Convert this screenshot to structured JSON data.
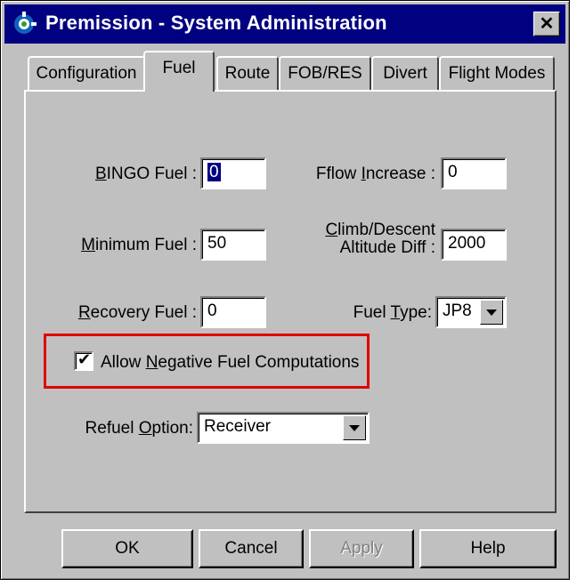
{
  "window": {
    "title": "Premission - System Administration",
    "close_glyph": "✕",
    "icon": "gear-app-icon"
  },
  "tabs": [
    {
      "label": "Configuration",
      "active": false
    },
    {
      "label": "Fuel",
      "active": true
    },
    {
      "label": "Route",
      "active": false
    },
    {
      "label": "FOB/RES",
      "active": false
    },
    {
      "label": "Divert",
      "active": false
    },
    {
      "label": "Flight Modes",
      "active": false
    }
  ],
  "fuel": {
    "bingo": {
      "label_ul": "B",
      "label_rest": "INGO Fuel :",
      "value": "0"
    },
    "flow_increase": {
      "label_pre": "Fflow ",
      "label_ul": "I",
      "label_rest": "ncrease :",
      "value": "0"
    },
    "minimum": {
      "label_ul": "M",
      "label_rest": "inimum Fuel :",
      "value": "50"
    },
    "climb": {
      "line1_ul": "C",
      "line1_rest": "limb/Descent",
      "line2": "Altitude Diff :",
      "value": "2000"
    },
    "recovery": {
      "label_ul": "R",
      "label_rest": "ecovery Fuel :",
      "value": "0"
    },
    "fuel_type": {
      "label_pre": "Fuel ",
      "label_ul": "T",
      "label_rest": "ype:",
      "value": "JP8"
    },
    "allow_negative": {
      "label_pre": "Allow ",
      "label_ul": "N",
      "label_rest": "egative Fuel Computations",
      "checked": true
    },
    "refuel_option": {
      "label_pre": "Refuel ",
      "label_ul": "O",
      "label_rest": "ption:",
      "value": "Receiver"
    }
  },
  "buttons": {
    "ok": "OK",
    "cancel": "Cancel",
    "apply": "Apply",
    "help": "Help"
  },
  "colors": {
    "titlebar": "#000080",
    "highlight": "#e00000"
  }
}
